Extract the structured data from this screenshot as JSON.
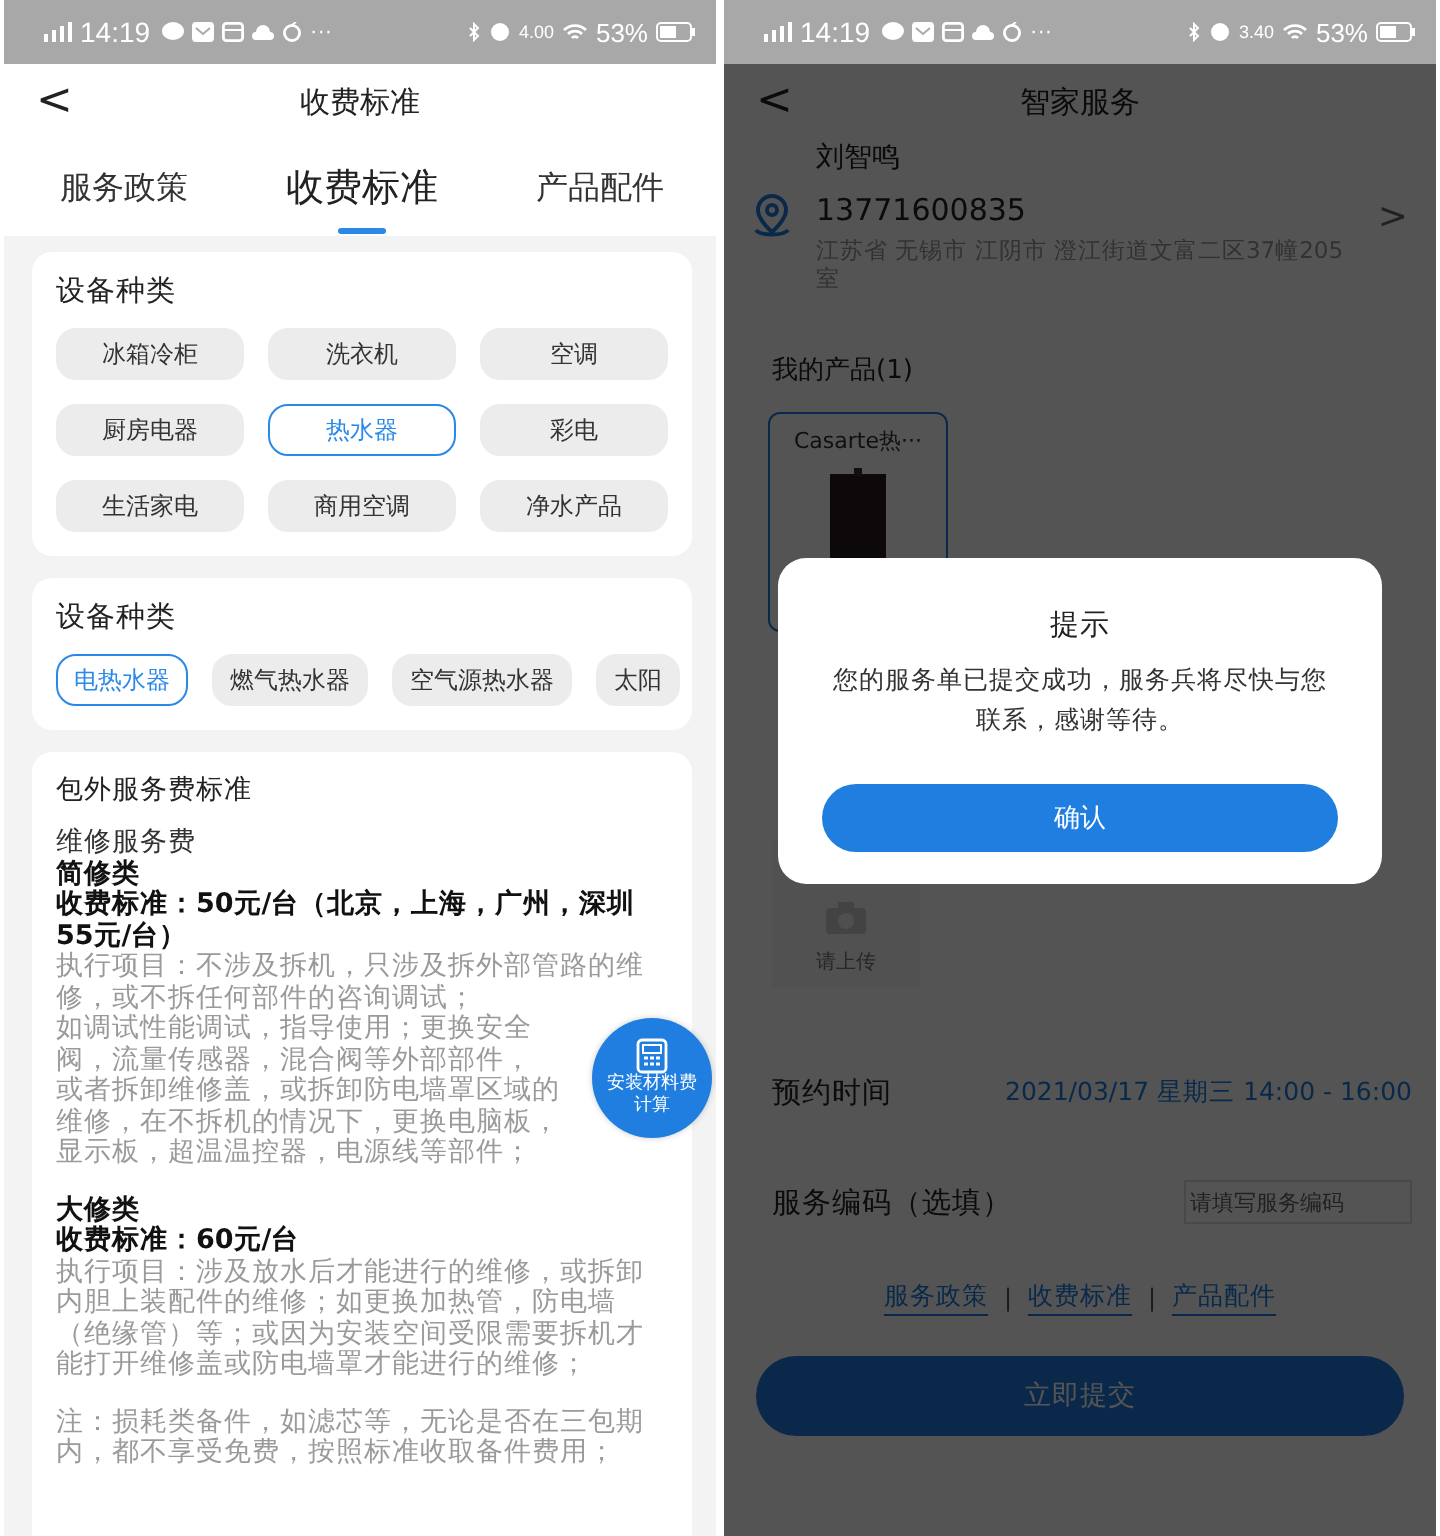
{
  "left": {
    "status_bar": {
      "time": "14:19",
      "more": "···",
      "speed": "4.00",
      "battery": "53%"
    },
    "header": {
      "back": "<",
      "title": "收费标准"
    },
    "tabs": [
      {
        "label": "服务政策",
        "selected": false
      },
      {
        "label": "收费标准",
        "selected": true
      },
      {
        "label": "产品配件",
        "selected": false
      }
    ],
    "sections": [
      {
        "title": "设备种类",
        "kind": "grid",
        "chips": [
          {
            "label": "冰箱冷柜",
            "selected": false
          },
          {
            "label": "洗衣机",
            "selected": false
          },
          {
            "label": "空调",
            "selected": false
          },
          {
            "label": "厨房电器",
            "selected": false
          },
          {
            "label": "热水器",
            "selected": true
          },
          {
            "label": "彩电",
            "selected": false
          },
          {
            "label": "生活家电",
            "selected": false
          },
          {
            "label": "商用空调",
            "selected": false
          },
          {
            "label": "净水产品",
            "selected": false
          }
        ]
      },
      {
        "title": "设备种类",
        "kind": "scroll",
        "chips": [
          {
            "label": "电热水器",
            "selected": true
          },
          {
            "label": "燃气热水器",
            "selected": false
          },
          {
            "label": "空气源热水器",
            "selected": false
          },
          {
            "label": "太阳",
            "selected": false
          }
        ]
      }
    ],
    "fee": {
      "title": "包外服务费标准",
      "blocks": [
        [
          {
            "kind": "plain",
            "text": "维修服务费"
          },
          {
            "kind": "bold",
            "text": "简修类"
          },
          {
            "kind": "bold",
            "text": "收费标准：50元/台（北京，上海，广州，深圳55元/台）"
          },
          {
            "kind": "gray",
            "text": "执行项目：不涉及拆机，只涉及拆外部管路的维修，或不拆任何部件的咨询调试；"
          },
          {
            "kind": "gray",
            "text": "如调试性能调试，指导使用；更换安全阀，流量传感器，混合阀等外部部件，"
          },
          {
            "kind": "gray",
            "text": "或者拆卸维修盖，或拆卸防电墙罩区域的维修，在不拆机的情况下，更换电脑板，显示板，超温温控器，电源线等部件；"
          }
        ],
        [
          {
            "kind": "bold",
            "text": "大修类"
          },
          {
            "kind": "bold",
            "text": "收费标准：60元/台"
          },
          {
            "kind": "gray",
            "text": "执行项目：涉及放水后才能进行的维修，或拆卸内胆上装配件的维修；如更换加热管，防电墙（绝缘管）等；或因为安装空间受限需要拆机才能打开维修盖或防电墙罩才能进行的维修；"
          }
        ],
        [
          {
            "kind": "gray",
            "text": "注：损耗类备件，如滤芯等，无论是否在三包期内，都不享受免费，按照标准收取备件费用；"
          }
        ]
      ]
    },
    "float_button": {
      "label": "安装材料费计算"
    }
  },
  "right": {
    "status_bar": {
      "time": "14:19",
      "more": "···",
      "speed": "3.40",
      "battery": "53%"
    },
    "header": {
      "back": "<",
      "title": "智家服务"
    },
    "address": {
      "name": "刘智鸣",
      "phone": "13771600835",
      "address": "江苏省 无锡市 江阴市 澄江街道文富二区37幢205室",
      "chevron": ">"
    },
    "products": {
      "title": "我的产品(1)",
      "items": [
        {
          "name": "Casarte热···",
          "selected": true
        }
      ]
    },
    "upload": {
      "label": "请上传"
    },
    "appointment": {
      "label": "预约时间",
      "value": "2021/03/17 星期三 14:00 - 16:00"
    },
    "service_code": {
      "label": "服务编码（选填）",
      "placeholder": "请填写服务编码"
    },
    "links": [
      "服务政策",
      "收费标准",
      "产品配件"
    ],
    "link_separator": "|",
    "submit": "立即提交",
    "dialog": {
      "title": "提示",
      "message": "您的服务单已提交成功，服务兵将尽快与您联系，感谢等待。",
      "confirm": "确认"
    }
  }
}
